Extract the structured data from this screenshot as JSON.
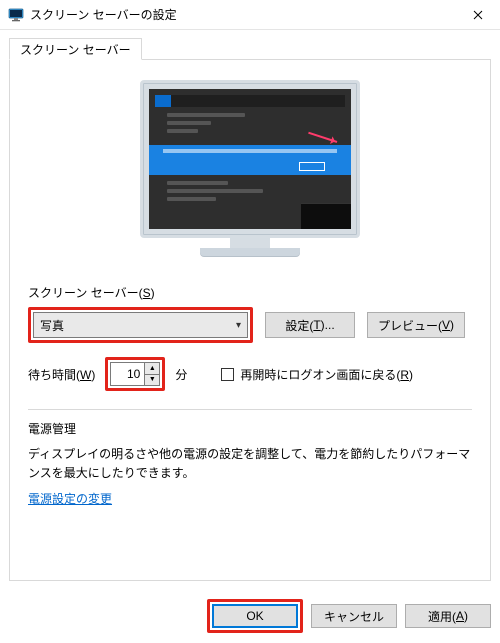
{
  "titlebar": {
    "title": "スクリーン セーバーの設定"
  },
  "tab": {
    "label": "スクリーン セーバー"
  },
  "group": {
    "label_prefix": "スクリーン セーバー(",
    "label_key": "S",
    "label_suffix": ")"
  },
  "combo": {
    "selected": "写真"
  },
  "buttons": {
    "settings_prefix": "設定(",
    "settings_key": "T",
    "settings_suffix": ")...",
    "preview_prefix": "プレビュー(",
    "preview_key": "V",
    "preview_suffix": ")"
  },
  "wait": {
    "label_prefix": "待ち時間(",
    "label_key": "W",
    "label_suffix": ")",
    "value": "10",
    "unit": "分"
  },
  "resume": {
    "label_prefix": "再開時にログオン画面に戻る(",
    "label_key": "R",
    "label_suffix": ")"
  },
  "power": {
    "title": "電源管理",
    "text": "ディスプレイの明るさや他の電源の設定を調整して、電力を節約したりパフォーマンスを最大にしたりできます。",
    "link": "電源設定の変更"
  },
  "footer": {
    "ok": "OK",
    "cancel": "キャンセル",
    "apply_prefix": "適用(",
    "apply_key": "A",
    "apply_suffix": ")"
  }
}
